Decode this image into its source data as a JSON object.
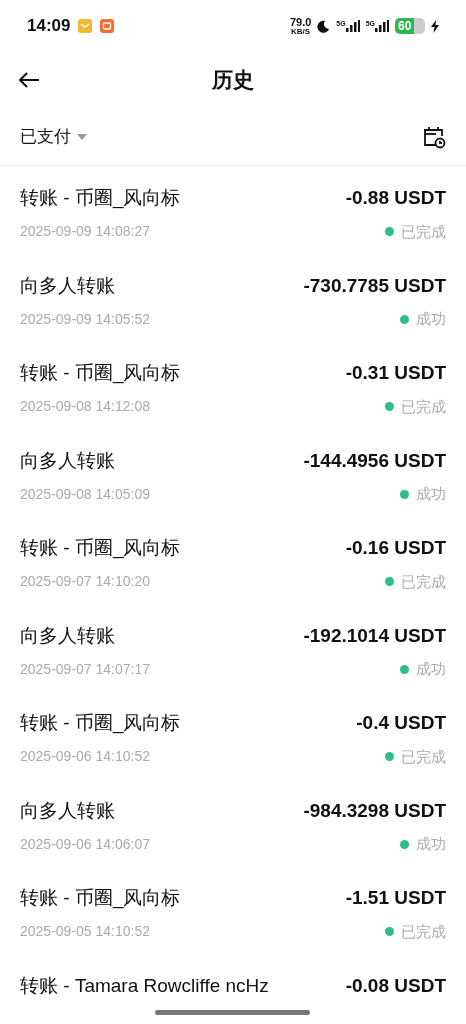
{
  "status_bar": {
    "time": "14:09",
    "speed": "79.0",
    "speed_unit": "KB/S",
    "network_1": "5G",
    "network_2": "5G",
    "battery": "60",
    "charging": true
  },
  "header": {
    "title": "历史"
  },
  "filter": {
    "label": "已支付"
  },
  "transactions": [
    {
      "title": "转账 - 币圈_风向标",
      "amount": "-0.88 USDT",
      "time": "2025-09-09 14:08:27",
      "status": "已完成"
    },
    {
      "title": "向多人转账",
      "amount": "-730.7785 USDT",
      "time": "2025-09-09 14:05:52",
      "status": "成功"
    },
    {
      "title": "转账 - 币圈_风向标",
      "amount": "-0.31 USDT",
      "time": "2025-09-08 14:12:08",
      "status": "已完成"
    },
    {
      "title": "向多人转账",
      "amount": "-144.4956 USDT",
      "time": "2025-09-08 14:05:09",
      "status": "成功"
    },
    {
      "title": "转账 - 币圈_风向标",
      "amount": "-0.16 USDT",
      "time": "2025-09-07 14:10:20",
      "status": "已完成"
    },
    {
      "title": "向多人转账",
      "amount": "-192.1014 USDT",
      "time": "2025-09-07 14:07:17",
      "status": "成功"
    },
    {
      "title": "转账 - 币圈_风向标",
      "amount": "-0.4 USDT",
      "time": "2025-09-06 14:10:52",
      "status": "已完成"
    },
    {
      "title": "向多人转账",
      "amount": "-984.3298 USDT",
      "time": "2025-09-06 14:06:07",
      "status": "成功"
    },
    {
      "title": "转账 - 币圈_风向标",
      "amount": "-1.51 USDT",
      "time": "2025-09-05 14:10:52",
      "status": "已完成"
    },
    {
      "title": "转账 - Tamara Rowcliffe ncHz",
      "amount": "-0.08 USDT"
    }
  ]
}
